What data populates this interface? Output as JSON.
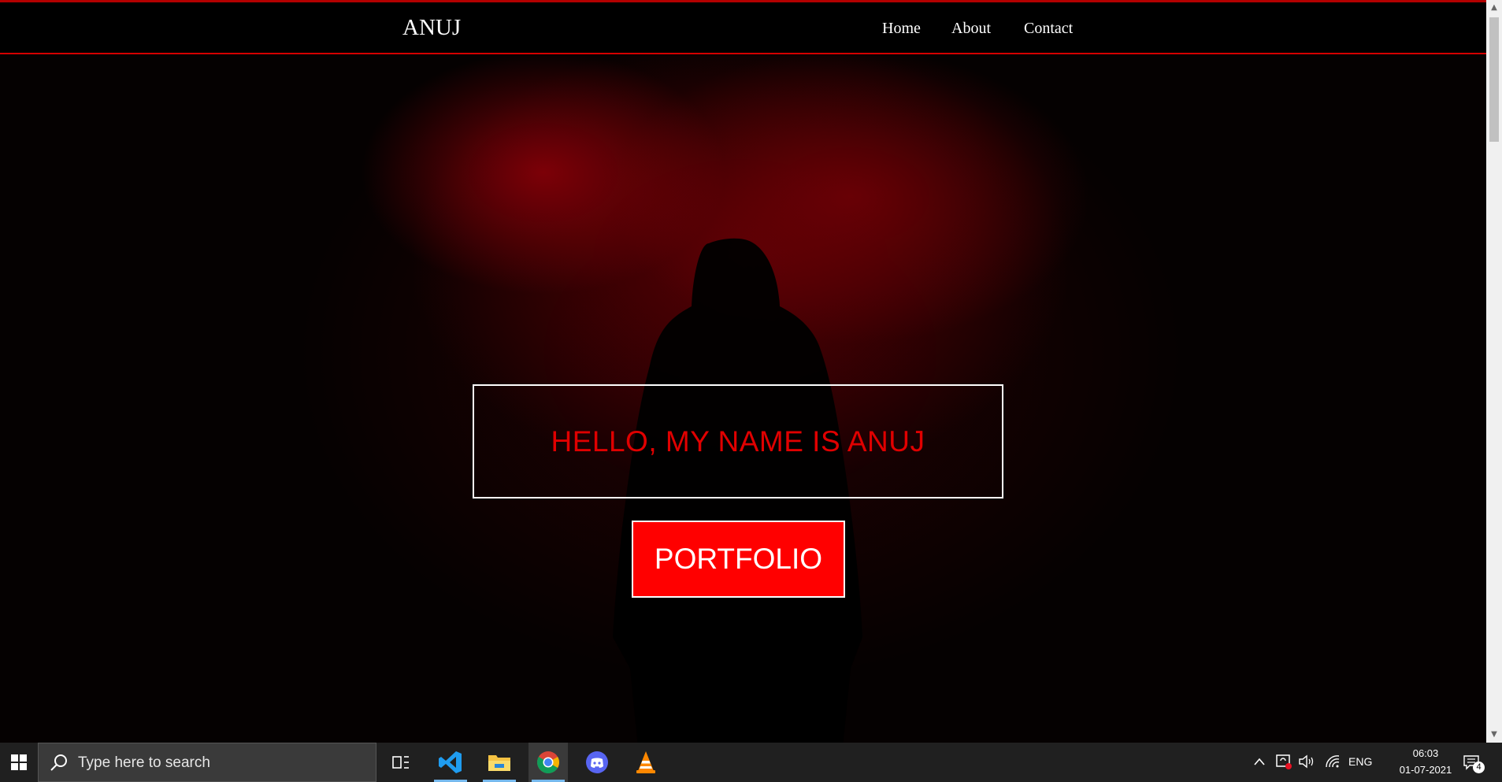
{
  "site": {
    "brand": "ANUJ",
    "nav": [
      {
        "label": "Home"
      },
      {
        "label": "About"
      },
      {
        "label": "Contact"
      }
    ],
    "hero": {
      "greeting": "HELLO, MY NAME IS ANUJ",
      "button_label": "PORTFOLIO"
    }
  },
  "colors": {
    "accent": "#ff0000",
    "greeting_text": "#e00000",
    "nav_border": "#d40000",
    "background": "#050101"
  },
  "taskbar": {
    "search_placeholder": "Type here to search",
    "apps": [
      {
        "icon": "task-view-icon"
      },
      {
        "icon": "vscode-icon"
      },
      {
        "icon": "file-explorer-icon"
      },
      {
        "icon": "chrome-icon",
        "active": true
      },
      {
        "icon": "discord-icon"
      },
      {
        "icon": "vlc-icon"
      }
    ],
    "tray": {
      "language": "ENG",
      "time": "06:03",
      "date": "01-07-2021",
      "notification_count": "4"
    }
  }
}
